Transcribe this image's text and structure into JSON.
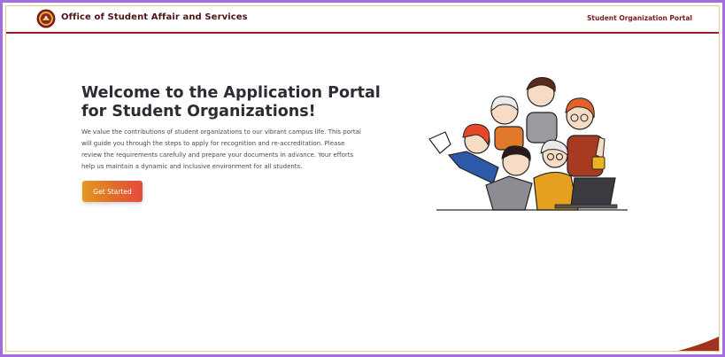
{
  "header": {
    "brand": "Office of Student Affair and Services",
    "portal_link": "Student Organization Portal",
    "logo_icon": "university-seal-icon"
  },
  "hero": {
    "title": "Welcome to the Application Portal for Student Organizations!",
    "description": "We value the contributions of student organizations to our vibrant campus life. This portal will guide you through the steps to apply for recognition and re-accreditation. Please review the requirements carefully and prepare your documents in advance. Your efforts help us maintain a dynamic and inclusive environment for all students.",
    "cta_label": "Get Started",
    "illustration_icon": "group-of-people-illustration"
  },
  "colors": {
    "brand_maroon": "#9b1c24",
    "cta_start": "#e39a1f",
    "cta_end": "#e44b3d",
    "frame_purple": "#a46de0"
  }
}
